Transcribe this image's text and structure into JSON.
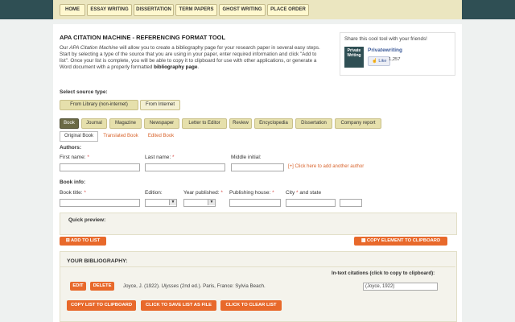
{
  "nav": {
    "items": [
      "HOME",
      "ESSAY WRITING",
      "DISSERTATION",
      "TERM PAPERS",
      "GHOST WRITING",
      "PLACE ORDER"
    ]
  },
  "header": {
    "title": "APA CITATION MACHINE - REFERENCING FORMAT TOOL",
    "intro_1": "Our ",
    "intro_em": "APA Citation Machine",
    "intro_2": " will allow you to create a bibliography page for your research paper in several easy steps. Start by selecting a type of the source that you are using in your paper, enter required information and click \"Add to list\". Once your list is complete, you will be able to copy it to clipboard for use with other applications, or generate a Word document with a properly formatted ",
    "intro_bold": "bibliography page",
    "intro_3": "."
  },
  "share": {
    "title": "Share this cool tool with your friends!",
    "logo_text": "Private Writing",
    "page_name": "Privatewriting",
    "like_label": "Like",
    "like_count": "1,257"
  },
  "source": {
    "label": "Select source type:",
    "buttons": [
      "From Library (non-internet)",
      "From Internet"
    ],
    "selected": "From Library (non-internet)"
  },
  "types": {
    "items": [
      "Book",
      "Journal",
      "Magazine",
      "Newspaper",
      "Letter to Editor",
      "Review",
      "Encyclopedia",
      "Dissertation",
      "Company report"
    ],
    "selected": "Book"
  },
  "subtabs": [
    "Original Book",
    "Translated Book",
    "Edited Book"
  ],
  "authors": {
    "label": "Authors:",
    "first": "First name:",
    "last": "Last name:",
    "middle": "Middle initial:",
    "add_link": "[+] Click here to add another author"
  },
  "bookinfo": {
    "label": "Book info:",
    "title": "Book title:",
    "edition": "Edition:",
    "year": "Year published:",
    "publisher": "Publishing house:",
    "city": "City",
    "state": " and state"
  },
  "preview": {
    "label": "Quick preview:"
  },
  "actions": {
    "add": "ADD TO LIST",
    "copy_element": "COPY ELEMENT TO CLIPBOARD"
  },
  "bibliography": {
    "title": "YOUR BIBLIOGRAPHY:",
    "intext_label": "In-text citations (click to copy to clipboard):",
    "edit": "EDIT",
    "delete": "DELETE",
    "entry_author": "Joyce, J. (1922). ",
    "entry_title": "Ulysses",
    "entry_rest": " (2nd ed.). Paris, France: Sylvia Beach.",
    "intext_value": "(Joyce, 1922)",
    "copy_list": "COPY LIST TO CLIPBOARD",
    "save_list": "CLICK TO SAVE LIST AS FILE",
    "clear_list": "CLICK TO CLEAR LIST"
  },
  "colors": {
    "accent_orange": "#e8692b",
    "nav_dark": "#2f4f54",
    "pill": "#e6e0ac",
    "pill_active": "#6b6a46"
  }
}
